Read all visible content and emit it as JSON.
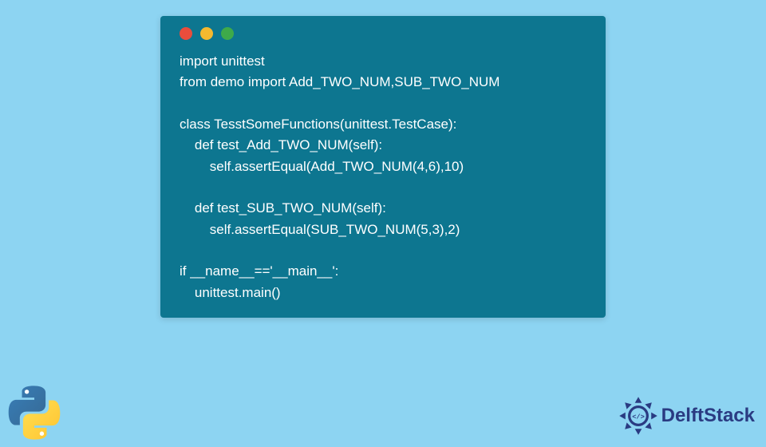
{
  "window": {
    "traffic_colors": {
      "red": "#e94d3c",
      "yellow": "#f5b92f",
      "green": "#3eaa4a"
    }
  },
  "code": {
    "lines": "import unittest\nfrom demo import Add_TWO_NUM,SUB_TWO_NUM\n\nclass TesstSomeFunctions(unittest.TestCase):\n    def test_Add_TWO_NUM(self):\n        self.assertEqual(Add_TWO_NUM(4,6),10)\n\n    def test_SUB_TWO_NUM(self):\n        self.assertEqual(SUB_TWO_NUM(5,3),2)\n\nif __name__=='__main__':\n    unittest.main()"
  },
  "branding": {
    "site_name": "DelftStack"
  }
}
